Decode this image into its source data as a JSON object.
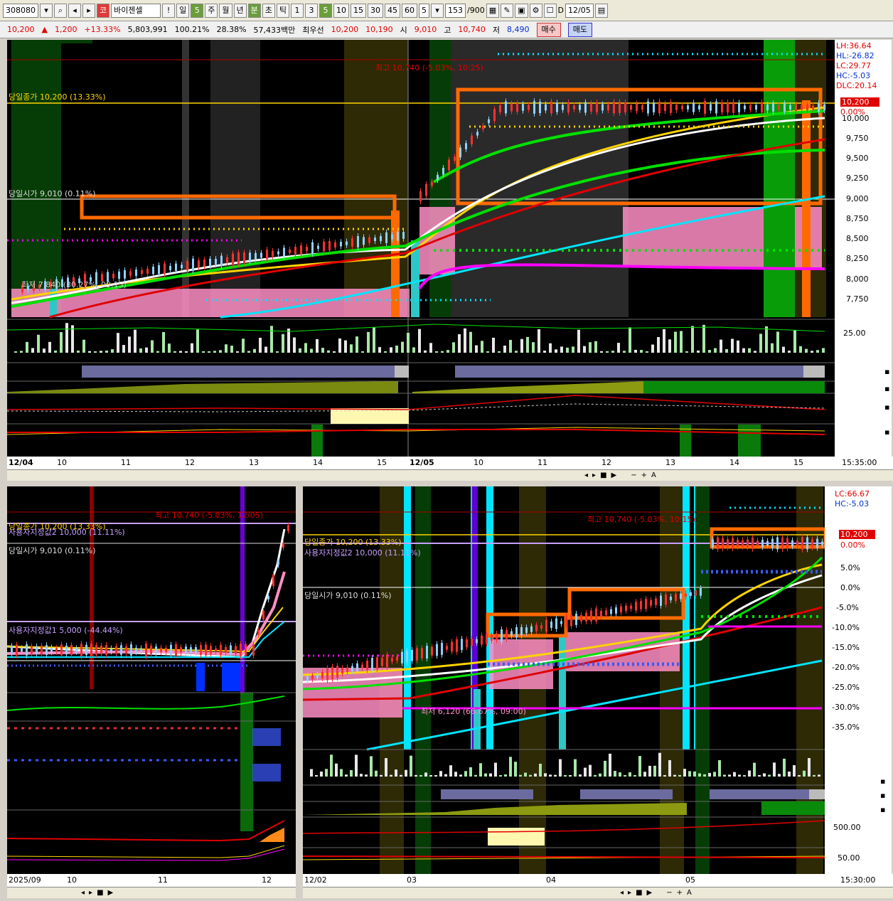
{
  "toolbar": {
    "code": "308080",
    "market_badge": "코",
    "stock_name": "바이젠셀",
    "period_buttons": [
      "일",
      "5",
      "주",
      "월",
      "년",
      "분",
      "초",
      "틱"
    ],
    "interval_buttons": [
      "1",
      "3",
      "5",
      "10",
      "15",
      "30",
      "45",
      "60"
    ],
    "interval_value": "5",
    "count": "153",
    "count_total": "/900",
    "date_label": "D",
    "date_value": "12/05"
  },
  "quote": {
    "price": "10,200",
    "change": "1,200",
    "change_pct": "+13.33%",
    "volume": "5,803,991",
    "vol_ratio": "100.21%",
    "turnover": "28.38%",
    "amount": "57,433백만",
    "best_bid_label": "최우선",
    "best_ask": "10,200",
    "best_bid": "10,190",
    "open_label": "시",
    "open": "9,010",
    "high_label": "고",
    "high": "10,740",
    "low_label": "저",
    "low": "8,490",
    "buy_label": "매수",
    "sell_label": "매도"
  },
  "top_chart": {
    "labels": {
      "high": "최고 10,740 (-5.03%, 10:25)",
      "close": "당일종가 10,200 (13.33%)",
      "open": "당일시가 9,010 (0.11%)",
      "low_note": "최저 7,840 (30.27%, 09:15)"
    },
    "price_axis": [
      "LH:36.64",
      "HL:-26.82",
      "LC:29.77",
      "HC:-5.03",
      "DLC:20.14",
      "10,200",
      "0.00%",
      "10,000",
      "9,750",
      "9,500",
      "9,250",
      "9,000",
      "8,750",
      "8,500",
      "8,250",
      "8,000",
      "7,750"
    ],
    "vol_axis": "25.00",
    "time_axis": [
      "12/04",
      "10",
      "11",
      "12",
      "13",
      "14",
      "15",
      "12/05",
      "10",
      "11",
      "12",
      "13",
      "14",
      "15"
    ],
    "time_stamp": "15:35:00"
  },
  "bottom_left": {
    "labels": {
      "high": "최고 10,740 (-5.03%, 12/05)",
      "close": "당일종가 10,200 (13.33%)",
      "user2": "사용자지정값2 10,000 (11.11%)",
      "open": "당일시가 9,010 (0.11%)",
      "user1": "사용자지정값1 5,000 (-44.44%)"
    },
    "time_axis": [
      "2025/09",
      "10",
      "11",
      "12"
    ]
  },
  "bottom_right": {
    "labels": {
      "high": "최고 10,740 (-5.03%, 10:15)",
      "close": "당일종가 10,200 (13.33%)",
      "user2": "사용자지정값2 10,000 (11.11%)",
      "open": "당일시가 9,010 (0.11%)",
      "low": "최저 6,120 (66.67%, 09:00)"
    },
    "pct_axis": [
      "LC:66.67",
      "HC:-5.03",
      "10,200",
      "0.00%",
      "5.0%",
      "0.0%",
      "-5.0%",
      "-10.0%",
      "-15.0%",
      "-20.0%",
      "-25.0%",
      "-30.0%",
      "-35.0%"
    ],
    "ind_axis": [
      "500.00",
      "50.00"
    ],
    "time_axis": [
      "12/02",
      "03",
      "04",
      "05"
    ],
    "time_stamp": "15:30:00"
  },
  "colors": {
    "bg": "#000000",
    "up": "#e00000",
    "down": "#4fb3ff",
    "orange": "#ff6a00",
    "yellow": "#ffd400",
    "green": "#00e000",
    "pink": "#ff8ec6",
    "magenta": "#ff00ff",
    "cyan": "#00e5ff"
  }
}
